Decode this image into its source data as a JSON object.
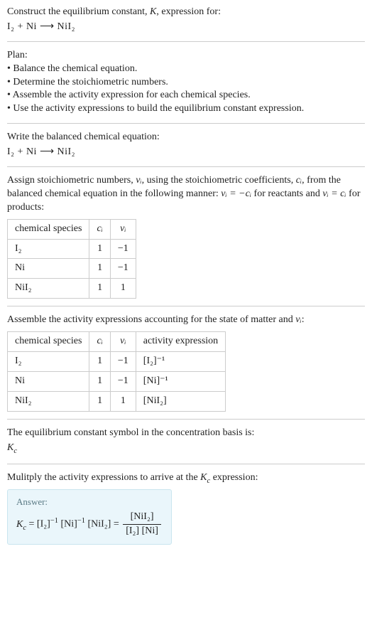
{
  "intro": {
    "line1_a": "Construct the equilibrium constant, ",
    "line1_K": "K",
    "line1_b": ", expression for:",
    "equation": "I₂ + Ni ⟶ NiI₂"
  },
  "plan": {
    "title": "Plan:",
    "items": [
      "• Balance the chemical equation.",
      "• Determine the stoichiometric numbers.",
      "• Assemble the activity expression for each chemical species.",
      "• Use the activity expressions to build the equilibrium constant expression."
    ]
  },
  "balanced": {
    "title": "Write the balanced chemical equation:",
    "equation": "I₂ + Ni ⟶ NiI₂"
  },
  "stoich": {
    "text_a": "Assign stoichiometric numbers, ",
    "nu": "νᵢ",
    "text_b": ", using the stoichiometric coefficients, ",
    "ci": "cᵢ",
    "text_c": ", from the balanced chemical equation in the following manner: ",
    "rel1": "νᵢ = −cᵢ",
    "text_d": " for reactants and ",
    "rel2": "νᵢ = cᵢ",
    "text_e": " for products:",
    "headers": {
      "species": "chemical species",
      "ci": "cᵢ",
      "nu": "νᵢ"
    },
    "rows": [
      {
        "sp": "I₂",
        "c": "1",
        "n": "−1"
      },
      {
        "sp": "Ni",
        "c": "1",
        "n": "−1"
      },
      {
        "sp": "NiI₂",
        "c": "1",
        "n": "1"
      }
    ]
  },
  "activity": {
    "title_a": "Assemble the activity expressions accounting for the state of matter and ",
    "nu": "νᵢ",
    "title_b": ":",
    "headers": {
      "species": "chemical species",
      "ci": "cᵢ",
      "nu": "νᵢ",
      "ae": "activity expression"
    },
    "rows": [
      {
        "sp": "I₂",
        "c": "1",
        "n": "−1",
        "ae": "[I₂]⁻¹"
      },
      {
        "sp": "Ni",
        "c": "1",
        "n": "−1",
        "ae": "[Ni]⁻¹"
      },
      {
        "sp": "NiI₂",
        "c": "1",
        "n": "1",
        "ae": "[NiI₂]"
      }
    ]
  },
  "eqconst": {
    "line": "The equilibrium constant symbol in the concentration basis is:",
    "symbol": "K_c"
  },
  "multiply": {
    "line_a": "Mulitply the activity expressions to arrive at the ",
    "kc": "K_c",
    "line_b": " expression:"
  },
  "answer": {
    "label": "Answer:",
    "lhs": "K_c = [I₂]⁻¹ [Ni]⁻¹ [NiI₂] = ",
    "frac_num": "[NiI₂]",
    "frac_den": "[I₂] [Ni]"
  }
}
